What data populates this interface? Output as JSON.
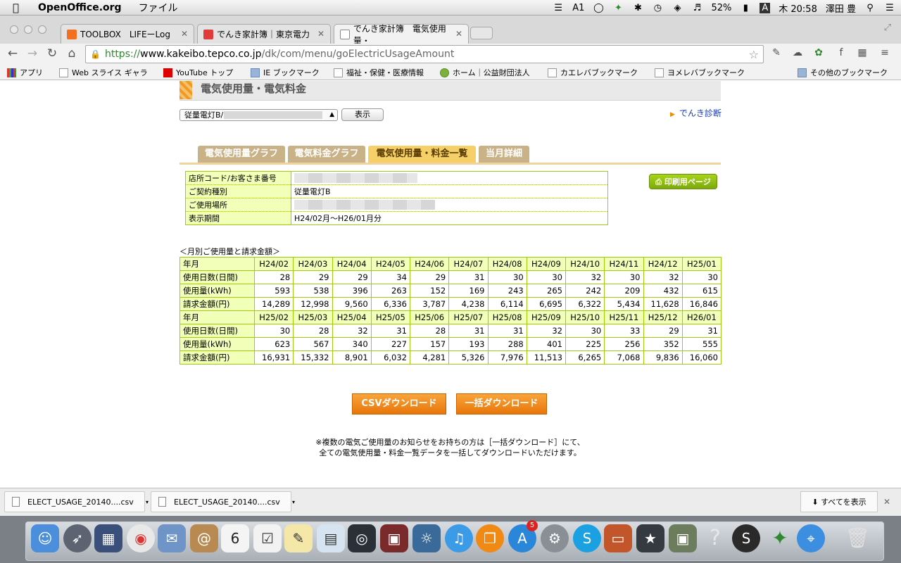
{
  "menubar": {
    "app_name": "OpenOffice.org",
    "menu_file": "ファイル",
    "adobe_count": "1",
    "battery": "52%",
    "input_mode": "A",
    "clock": "木 20:58",
    "user": "澤田 豊"
  },
  "tabs": [
    {
      "label": "TOOLBOX　LIFEーLog"
    },
    {
      "label": "でんき家計簿｜東京電力"
    },
    {
      "label": "でんき家計簿　電気使用量・"
    }
  ],
  "address": {
    "scheme": "https://",
    "host": "www.kakeibo.tepco.co.jp",
    "path": "/dk/com/menu/goElectricUsageAmount"
  },
  "bookmarks": [
    {
      "label": "アプリ"
    },
    {
      "label": "Web スライス ギャラ"
    },
    {
      "label": "YouTube トップ"
    },
    {
      "label": "IE ブックマーク"
    },
    {
      "label": "福祉・保健・医療情報"
    },
    {
      "label": "ホーム｜公益財団法人"
    },
    {
      "label": "カエレバブックマーク"
    },
    {
      "label": "ヨメレバブックマーク"
    },
    {
      "label": "その他のブックマーク"
    }
  ],
  "page": {
    "title": "電気使用量・電気料金",
    "meter_select": "従量電灯B/",
    "show_button": "表示",
    "denki_link": "でんき診断",
    "content_tabs": [
      {
        "label": "電気使用量グラフ"
      },
      {
        "label": "電気料金グラフ"
      },
      {
        "label": "電気使用量・料金一覧"
      },
      {
        "label": "当月詳細"
      }
    ],
    "print_button": "印刷用ページ",
    "info": {
      "store_label": "店所コード/お客さま番号",
      "contract_label": "ご契約種別",
      "contract_value": "従量電灯B",
      "location_label": "ご使用場所",
      "period_label": "表示期間",
      "period_value": "H24/02月～H26/01月分"
    },
    "caption": "＜月別ご使用量と請求金額＞",
    "row_labels": {
      "month": "年月",
      "days": "使用日数(日間)",
      "kwh": "使用量(kWh)",
      "yen": "請求金額(円)"
    },
    "blocks": [
      {
        "months": [
          "H24/02",
          "H24/03",
          "H24/04",
          "H24/05",
          "H24/06",
          "H24/07",
          "H24/08",
          "H24/09",
          "H24/10",
          "H24/11",
          "H24/12",
          "H25/01"
        ],
        "days": [
          "28",
          "29",
          "29",
          "34",
          "29",
          "31",
          "30",
          "30",
          "32",
          "30",
          "32",
          "30"
        ],
        "kwh": [
          "593",
          "538",
          "396",
          "263",
          "152",
          "169",
          "243",
          "265",
          "242",
          "209",
          "432",
          "615"
        ],
        "yen": [
          "14,289",
          "12,998",
          "9,560",
          "6,336",
          "3,787",
          "4,238",
          "6,114",
          "6,695",
          "6,322",
          "5,434",
          "11,628",
          "16,846"
        ]
      },
      {
        "months": [
          "H25/02",
          "H25/03",
          "H25/04",
          "H25/05",
          "H25/06",
          "H25/07",
          "H25/08",
          "H25/09",
          "H25/10",
          "H25/11",
          "H25/12",
          "H26/01"
        ],
        "days": [
          "30",
          "28",
          "32",
          "31",
          "28",
          "31",
          "31",
          "32",
          "30",
          "33",
          "29",
          "31"
        ],
        "kwh": [
          "623",
          "567",
          "340",
          "227",
          "157",
          "193",
          "288",
          "401",
          "225",
          "256",
          "352",
          "555"
        ],
        "yen": [
          "16,931",
          "15,332",
          "8,901",
          "6,032",
          "4,281",
          "5,326",
          "7,976",
          "11,513",
          "6,265",
          "7,068",
          "9,836",
          "16,060"
        ]
      }
    ],
    "csv_button": "CSVダウンロード",
    "bulk_button": "一括ダウンロード",
    "note_line1": "※複数の電気ご使用量のお知らせをお持ちの方は［一括ダウンロード］にて、",
    "note_line2": "全ての電気使用量・料金一覧データを一括してダウンロードいただけます。"
  },
  "downloads": {
    "items": [
      {
        "label": "ELECT_USAGE_20140....csv"
      },
      {
        "label": "ELECT_USAGE_20140....csv"
      }
    ],
    "show_all": "すべてを表示"
  },
  "dock": {
    "calendar_day": "6",
    "appstore_badge": "5"
  },
  "colors": {
    "table_border": "#9fcd0e",
    "table_header_bg": "#f1ffb8",
    "download_button": "#f08a14",
    "active_tab": "#f5cf68",
    "link": "#1a3bbd"
  }
}
